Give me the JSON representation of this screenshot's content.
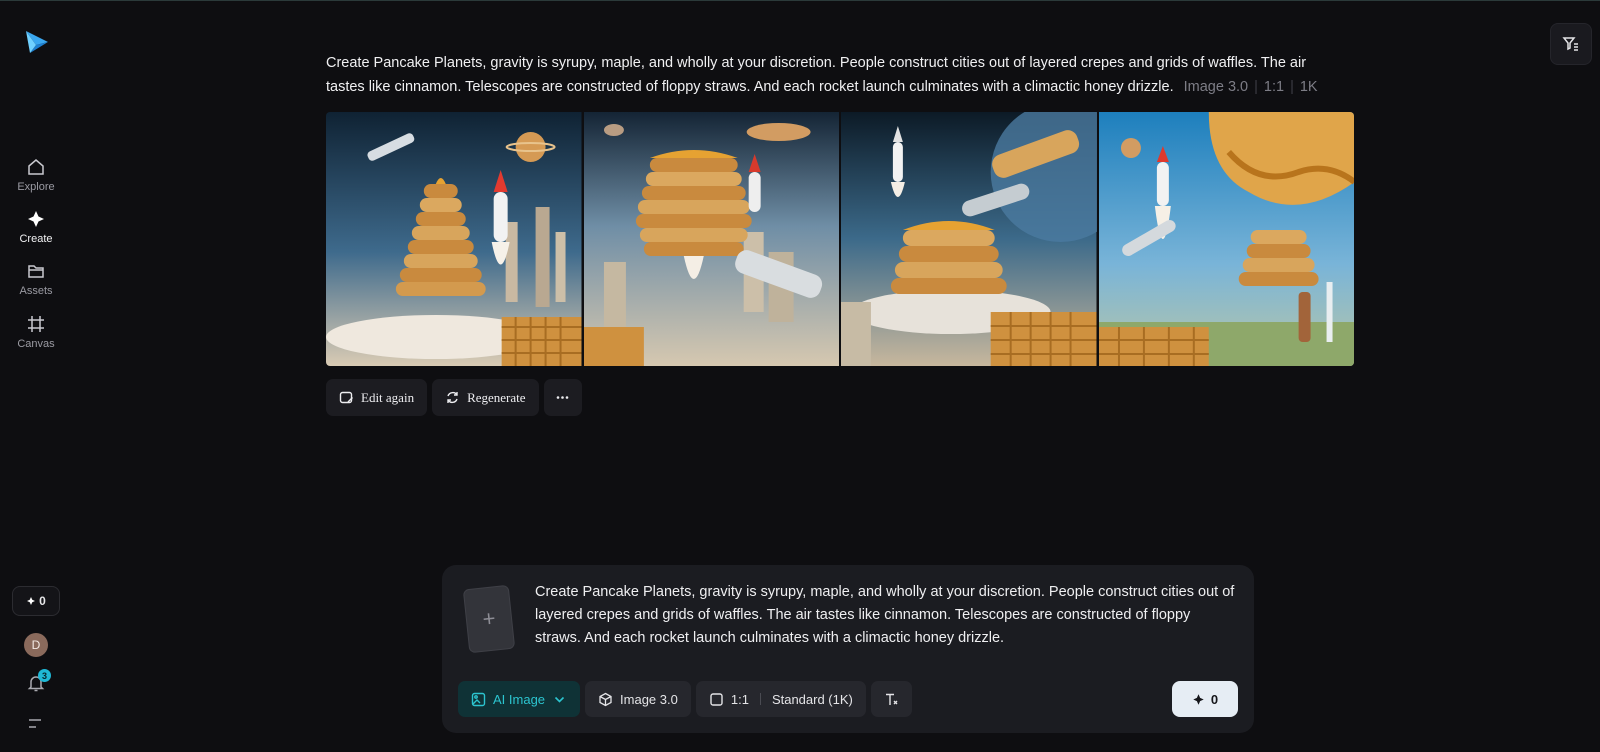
{
  "sidebar": {
    "items": [
      {
        "label": "Explore"
      },
      {
        "label": "Create"
      },
      {
        "label": "Assets"
      },
      {
        "label": "Canvas"
      }
    ],
    "credits": "0",
    "avatar_initial": "D",
    "notification_count": "3"
  },
  "prompt": {
    "text": "Create Pancake Planets, gravity is syrupy, maple, and wholly at your discretion. People construct cities out of layered crepes and grids of waffles. The air tastes like cinnamon. Telescopes are constructed of floppy straws. And each rocket launch culminates with a climactic honey drizzle.",
    "model": "Image 3.0",
    "ratio": "1:1",
    "resolution": "1K"
  },
  "actions": {
    "edit_again": "Edit again",
    "regenerate": "Regenerate"
  },
  "composer": {
    "text": "Create Pancake Planets, gravity is syrupy, maple, and wholly at your discretion. People construct cities out of layered crepes and grids of waffles. The air tastes like cinnamon. Telescopes are constructed of floppy straws. And each rocket launch culminates with a climactic honey drizzle.",
    "mode": "AI Image",
    "model": "Image 3.0",
    "ratio": "1:1",
    "quality": "Standard (1K)",
    "submit_cost": "0"
  },
  "colors": {
    "accent": "#2cc4cf",
    "background": "#0e0e11"
  }
}
